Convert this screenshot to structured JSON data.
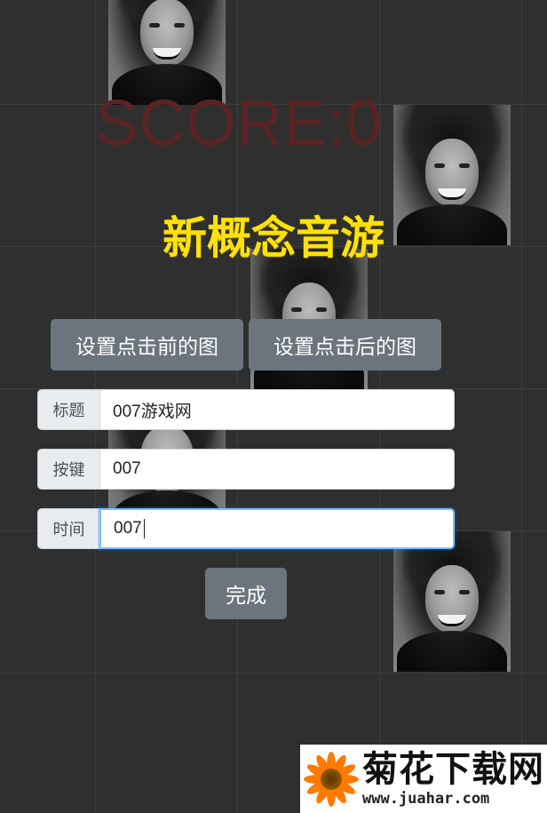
{
  "game": {
    "score_text": "SCORE:0",
    "title": "新概念音游",
    "colors": {
      "title": "#fde10a",
      "score": "#5b2424",
      "button": "#6c757d",
      "background": "#2f2f2f"
    }
  },
  "buttons": {
    "set_before_image": "设置点击前的图",
    "set_after_image": "设置点击后的图",
    "done": "完成"
  },
  "form": {
    "title_label": "标题",
    "title_value": "007游戏网",
    "key_label": "按键",
    "key_value": "007",
    "time_label": "时间",
    "time_value": "007"
  },
  "tiles": {
    "icon": "meme-face-tile"
  },
  "watermark": {
    "name": "菊花下载网",
    "url": "www.juahar.com",
    "icon": "chrysanthemum-logo-icon"
  }
}
